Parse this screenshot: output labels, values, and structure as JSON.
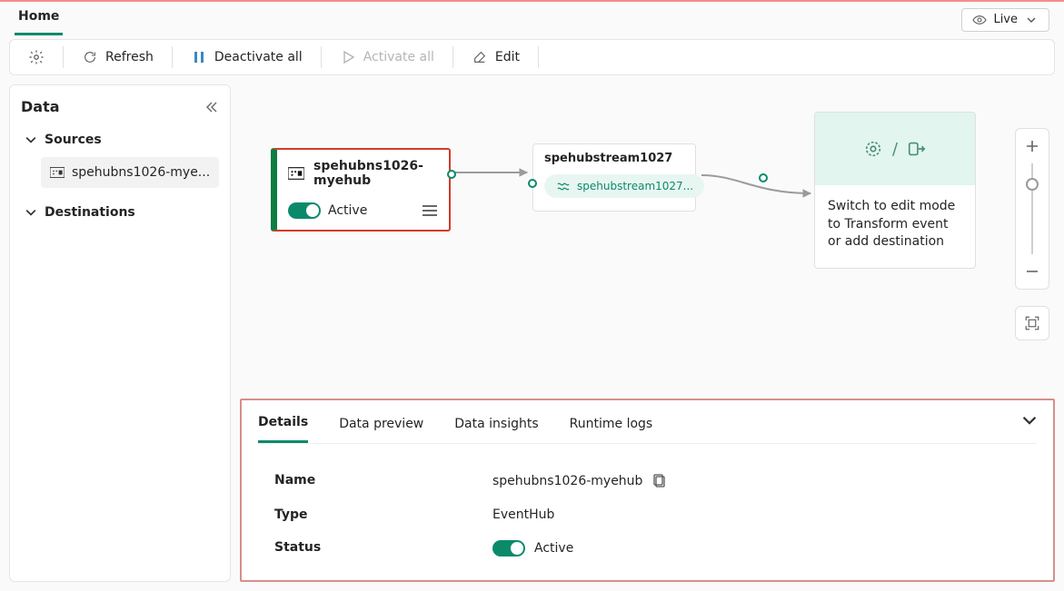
{
  "header": {
    "tabs": [
      {
        "label": "Home",
        "active": true
      }
    ],
    "live_label": "Live"
  },
  "commandbar": {
    "refresh": "Refresh",
    "deactivate_all": "Deactivate all",
    "activate_all": "Activate all",
    "edit": "Edit"
  },
  "sidebar": {
    "title": "Data",
    "sections": {
      "sources": {
        "label": "Sources",
        "items": [
          {
            "label": "spehubns1026-mye..."
          }
        ]
      },
      "destinations": {
        "label": "Destinations"
      }
    }
  },
  "canvas": {
    "source_node": {
      "title": "spehubns1026-myehub",
      "status_label": "Active"
    },
    "stream_node": {
      "title": "spehubstream1027",
      "pill_label": "spehubstream1027..."
    },
    "placard": {
      "text": "Switch to edit mode to Transform event or add destination"
    }
  },
  "bottom_panel": {
    "tabs": {
      "details": "Details",
      "data_preview": "Data preview",
      "data_insights": "Data insights",
      "runtime_logs": "Runtime logs"
    },
    "details": {
      "name_label": "Name",
      "name_value": "spehubns1026-myehub",
      "type_label": "Type",
      "type_value": "EventHub",
      "status_label": "Status",
      "status_value": "Active"
    }
  }
}
